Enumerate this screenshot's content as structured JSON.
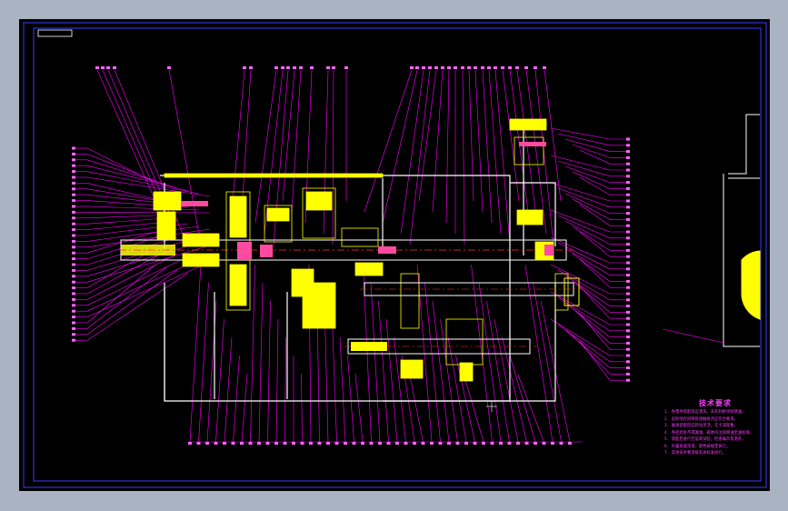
{
  "drawing": {
    "background": "#000000",
    "frame_color": "#3a3cff",
    "section_color": "#ffff00",
    "leader_color": "#ff00ff",
    "title_block_text": ""
  },
  "notes": {
    "title": "技术要求",
    "lines": [
      "1. 各零件装配前应清洗，去毛刺并涂防锈油。",
      "2. 齿轮啮合间隙及接触斑点应符合要求。",
      "3. 轴承装配后应转动灵活，无卡滞现象。",
      "4. 各密封处不得漏油，箱体内注润滑油至油标线。",
      "5. 装配后进行空运转试验，检查噪声及温升。",
      "6. 外露表面涂漆，颜色按规定执行。",
      "7. 其余技术要求按有关标准执行。"
    ]
  }
}
